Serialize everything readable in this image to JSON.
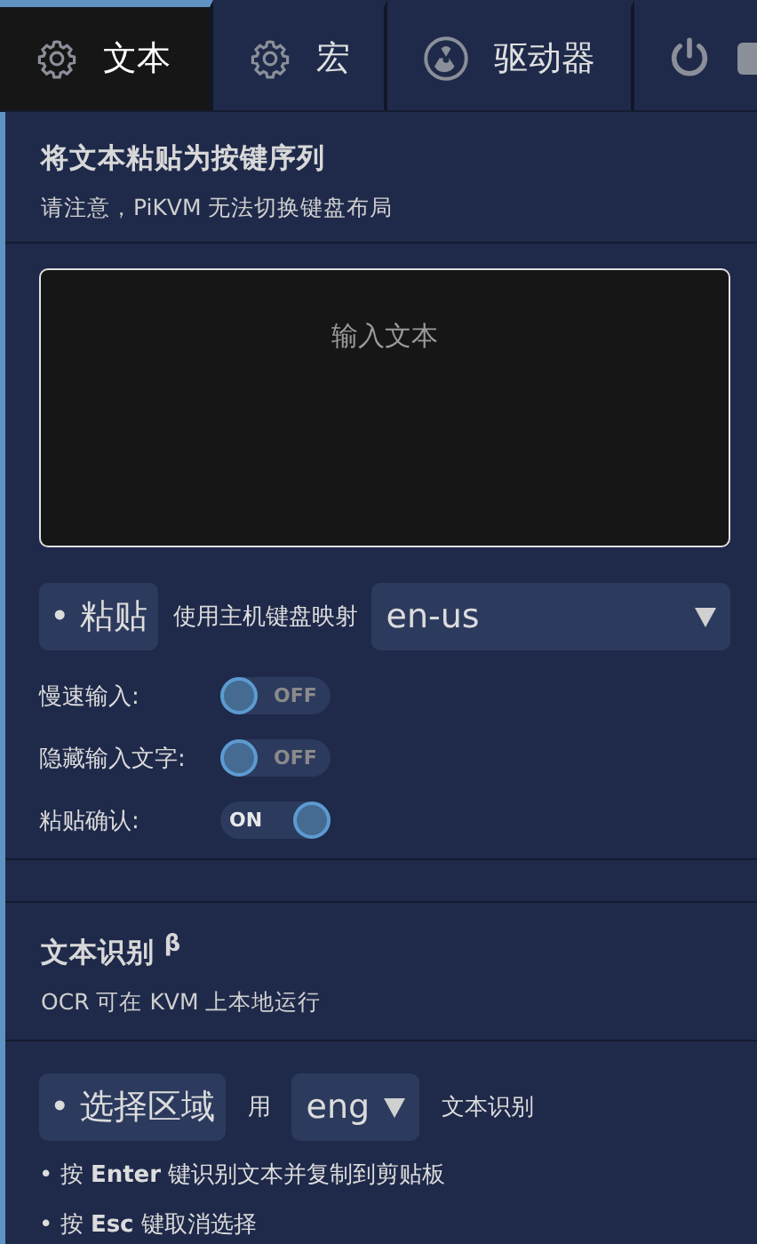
{
  "tabs": [
    {
      "kind": "gear",
      "label": "文本",
      "selected": true
    },
    {
      "kind": "gear",
      "label": "宏",
      "selected": false
    },
    {
      "kind": "drive",
      "label": "驱动器",
      "selected": false
    },
    {
      "kind": "power",
      "selected": false
    }
  ],
  "paste": {
    "title": "将文本粘贴为按键序列",
    "note": "请注意，PiKVM 无法切换键盘布局",
    "textarea": {
      "placeholder": "输入文本"
    },
    "button": "• 粘贴",
    "map_label": "使用主机键盘映射",
    "keymap": "en-us",
    "toggles": [
      {
        "label": "慢速输入:",
        "on": false,
        "state_label": "OFF"
      },
      {
        "label": "隐藏输入文字:",
        "on": false,
        "state_label": "OFF"
      },
      {
        "label": "粘贴确认:",
        "on": true,
        "state_label": "ON"
      }
    ]
  },
  "ocr": {
    "title": "文本识别 $^{β}$",
    "note": "OCR 可在 KVM 上本地运行",
    "button": "• 选择区域",
    "with_label": "用",
    "language": "eng",
    "after_label": "文本识别",
    "hints": [
      "• 按 **Enter** 键识别文本并复制到剪贴板",
      "• 按 **Esc** 键取消选择"
    ]
  }
}
